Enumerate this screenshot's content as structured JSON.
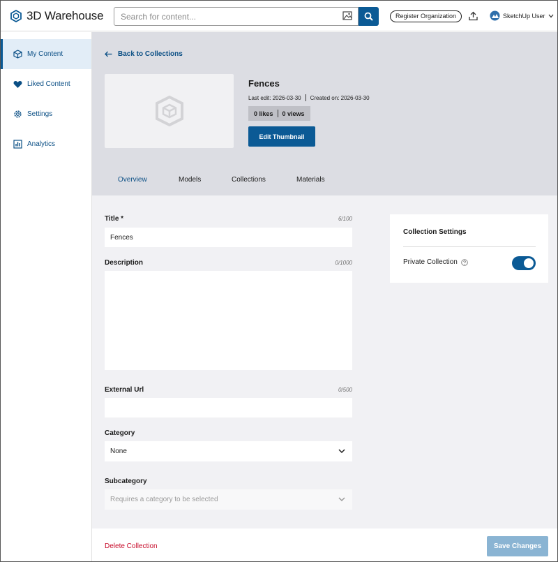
{
  "header": {
    "logo_text": "3D Warehouse",
    "search_placeholder": "Search for content...",
    "register_label": "Register Organization",
    "user_name": "SketchUp User"
  },
  "sidebar": {
    "items": [
      {
        "label": "My Content",
        "icon": "cube-icon",
        "active": true
      },
      {
        "label": "Liked Content",
        "icon": "heart-icon",
        "active": false
      },
      {
        "label": "Settings",
        "icon": "gear-icon",
        "active": false
      },
      {
        "label": "Analytics",
        "icon": "bar-chart-icon",
        "active": false
      }
    ]
  },
  "hero": {
    "back_label": "Back to Collections",
    "collection_title": "Fences",
    "last_edit": "Last edit: 2026-03-30",
    "created_on": "Created on: 2026-03-30",
    "likes": "0 likes",
    "views": "0 views",
    "edit_thumbnail_label": "Edit Thumbnail",
    "tabs": [
      {
        "label": "Overview",
        "active": true
      },
      {
        "label": "Models",
        "active": false
      },
      {
        "label": "Collections",
        "active": false
      },
      {
        "label": "Materials",
        "active": false
      }
    ]
  },
  "form": {
    "title_label": "Title  *",
    "title_count": "6/100",
    "title_value": "Fences",
    "description_label": "Description",
    "description_count": "0/1000",
    "description_value": "",
    "url_label": "External Url",
    "url_count": "0/500",
    "url_value": "",
    "category_label": "Category",
    "category_value": "None",
    "subcategory_label": "Subcategory",
    "subcategory_value": "Requires a category to be selected"
  },
  "settings_card": {
    "title": "Collection Settings",
    "private_label": "Private Collection",
    "private_enabled": true
  },
  "footer": {
    "delete_label": "Delete Collection",
    "save_label": "Save Changes"
  },
  "colors": {
    "primary": "#0b5a95",
    "link": "#0b4f85",
    "danger": "#c8102e",
    "disabled_button": "#8ab4d3",
    "hero_bg": "#dcdde3",
    "content_bg": "#f1f1f4"
  }
}
